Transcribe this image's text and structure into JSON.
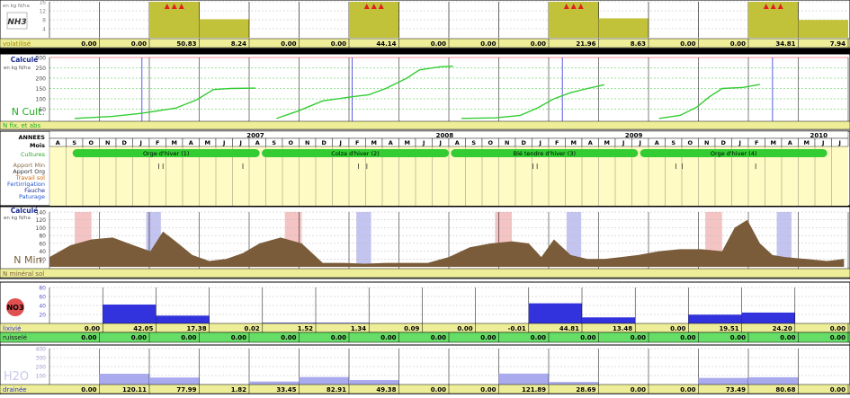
{
  "colors": {
    "olive": "#c2c23a",
    "yellow_bg": "#fffbc4",
    "green_bar": "#33cc33",
    "green_row": "#66dd66",
    "grid_green": "#33cc33",
    "grid_red": "#ee3333",
    "grid_gray": "#bbbbbb",
    "blue_line": "#3333dd",
    "nmin_fill": "#7a5c3a",
    "nitrate_fill": "#3333dd",
    "water_fill": "#aaaaee",
    "value_row": "#eeee99",
    "frame": "#000000"
  },
  "panels": {
    "nh3": {
      "unit": "en kg N/ha",
      "badge": "NH3",
      "row_label": "volatilisé",
      "warning_icon": "triangle-warning-icon",
      "chart_data": {
        "type": "bar",
        "ylim": [
          0,
          16
        ],
        "yticks": [
          4,
          8,
          12,
          16
        ],
        "categories": [
          "1",
          "2",
          "3",
          "4",
          "5",
          "6",
          "7",
          "8",
          "9",
          "10",
          "11",
          "12",
          "13",
          "14",
          "15",
          "16"
        ],
        "values": [
          0.0,
          0.0,
          50.83,
          8.24,
          0.0,
          0.0,
          44.14,
          0.0,
          0.0,
          0.0,
          21.96,
          8.63,
          0.0,
          0.0,
          34.81,
          7.94
        ],
        "labels": [
          "0.00",
          "0.00",
          "50.83",
          "8.24",
          "0.00",
          "0.00",
          "44.14",
          "0.00",
          "0.00",
          "0.00",
          "21.96",
          "8.63",
          "0.00",
          "0.00",
          "34.81",
          "7.94"
        ],
        "warnings": [
          2,
          6,
          10,
          14
        ]
      }
    },
    "ncult": {
      "header": "Calculé",
      "unit": "en kg N/ha",
      "title": "N Cult.",
      "footer": "N fix. et abs",
      "chart_data": {
        "type": "line",
        "ylim": [
          0,
          300
        ],
        "yticks": [
          50,
          100,
          150,
          200,
          250,
          300
        ],
        "series": [
          {
            "segment": 1,
            "points": [
              [
                0.6,
                5
              ],
              [
                1.5,
                15
              ],
              [
                2.2,
                30
              ],
              [
                3.0,
                55
              ],
              [
                3.5,
                95
              ],
              [
                3.9,
                145
              ],
              [
                4.3,
                150
              ],
              [
                4.9,
                152
              ]
            ]
          },
          {
            "segment": 2,
            "points": [
              [
                5.4,
                5
              ],
              [
                5.9,
                40
              ],
              [
                6.5,
                90
              ],
              [
                7.2,
                110
              ],
              [
                7.6,
                120
              ],
              [
                8.0,
                150
              ],
              [
                8.5,
                200
              ],
              [
                8.8,
                240
              ],
              [
                9.3,
                255
              ],
              [
                9.6,
                258
              ]
            ]
          },
          {
            "segment": 3,
            "points": [
              [
                9.8,
                5
              ],
              [
                10.6,
                8
              ],
              [
                11.2,
                20
              ],
              [
                11.6,
                55
              ],
              [
                12.0,
                100
              ],
              [
                12.4,
                130
              ],
              [
                12.8,
                150
              ],
              [
                13.2,
                168
              ]
            ]
          },
          {
            "segment": 4,
            "points": [
              [
                14.5,
                5
              ],
              [
                15.0,
                20
              ],
              [
                15.4,
                60
              ],
              [
                15.7,
                110
              ],
              [
                16.0,
                150
              ],
              [
                16.5,
                155
              ],
              [
                16.9,
                170
              ]
            ]
          }
        ]
      }
    },
    "calendar": {
      "row_labels": [
        "ANNEES",
        "Mois",
        "Cultures",
        "Apport Min",
        "Apport Org",
        "Travail sol",
        "Fertirrigation",
        "Fauche",
        "Paturage"
      ],
      "years": [
        {
          "label": "2007",
          "pos": 4.9
        },
        {
          "label": "2008",
          "pos": 9.4
        },
        {
          "label": "2009",
          "pos": 13.9
        },
        {
          "label": "2010",
          "pos": 18.3
        }
      ],
      "months": [
        "A",
        "S",
        "O",
        "N",
        "D",
        "J",
        "F",
        "M",
        "A",
        "M",
        "J",
        "J",
        "A",
        "S",
        "O",
        "N",
        "D",
        "J",
        "F",
        "M",
        "A",
        "M",
        "J",
        "J",
        "A",
        "S",
        "O",
        "N",
        "D",
        "J",
        "F",
        "M",
        "A",
        "M",
        "J",
        "J",
        "A",
        "S",
        "O",
        "N",
        "D",
        "J",
        "F",
        "M",
        "A",
        "M",
        "J",
        "J"
      ],
      "crops": [
        {
          "label": "Orge d'hiver (1)",
          "start": 0.55,
          "end": 5.0
        },
        {
          "label": "Colza d'hiver (2)",
          "start": 5.05,
          "end": 9.5
        },
        {
          "label": "Blé tendre d'hiver (3)",
          "start": 9.55,
          "end": 14.0
        },
        {
          "label": "Orge d'hiver (4)",
          "start": 14.05,
          "end": 18.5
        }
      ],
      "events": [
        2.6,
        2.7,
        4.6,
        7.35,
        7.55,
        11.5,
        11.6,
        14.9,
        15.05,
        16.8
      ]
    },
    "nmin": {
      "header": "Calculé",
      "unit": "en kg N/ha",
      "title": "N Min.",
      "footer": "N minéral sol",
      "chart_data": {
        "type": "area",
        "ylim": [
          0,
          140
        ],
        "yticks": [
          20,
          40,
          60,
          80,
          100,
          120,
          140
        ],
        "x": [
          0,
          0.5,
          1.0,
          1.5,
          2.0,
          2.4,
          2.7,
          3.0,
          3.4,
          3.8,
          4.2,
          4.6,
          5.0,
          5.5,
          6.0,
          6.5,
          7.0,
          7.5,
          8.0,
          8.5,
          9.0,
          9.5,
          10.0,
          10.5,
          11.0,
          11.4,
          11.7,
          12.0,
          12.4,
          12.8,
          13.2,
          13.6,
          14.0,
          14.5,
          15.0,
          15.5,
          16.0,
          16.3,
          16.6,
          16.9,
          17.2,
          17.5,
          18.0,
          18.5,
          18.9
        ],
        "values": [
          25,
          55,
          70,
          75,
          55,
          40,
          90,
          65,
          30,
          15,
          20,
          35,
          60,
          75,
          60,
          10,
          10,
          8,
          10,
          10,
          10,
          25,
          50,
          60,
          65,
          60,
          25,
          70,
          30,
          20,
          20,
          25,
          30,
          40,
          45,
          45,
          40,
          100,
          120,
          60,
          30,
          25,
          20,
          15,
          20
        ],
        "shading": [
          {
            "kind": "red",
            "start": 0.6,
            "end": 1.0
          },
          {
            "kind": "blue",
            "start": 2.3,
            "end": 2.65
          },
          {
            "kind": "red",
            "start": 5.6,
            "end": 6.0
          },
          {
            "kind": "blue",
            "start": 7.3,
            "end": 7.65
          },
          {
            "kind": "red",
            "start": 10.6,
            "end": 11.0
          },
          {
            "kind": "blue",
            "start": 12.3,
            "end": 12.65
          },
          {
            "kind": "red",
            "start": 15.6,
            "end": 16.0
          },
          {
            "kind": "blue",
            "start": 17.3,
            "end": 17.65
          }
        ]
      }
    },
    "no3": {
      "badge": "NO3",
      "row_labels": [
        "lixivié",
        "ruisselé"
      ],
      "chart_data": {
        "type": "bar",
        "ylim": [
          0,
          80
        ],
        "yticks": [
          20,
          40,
          60,
          80
        ],
        "values": [
          0.0,
          42.05,
          17.38,
          0.02,
          1.52,
          1.34,
          0.09,
          0.0,
          -0.01,
          44.81,
          13.48,
          0.0,
          19.51,
          24.2,
          0.0
        ],
        "labels_lixivie": [
          "0.00",
          "42.05",
          "17.38",
          "0.02",
          "1.52",
          "1.34",
          "0.09",
          "0.00",
          "-0.01",
          "44.81",
          "13.48",
          "0.00",
          "19.51",
          "24.20",
          "0.00"
        ],
        "labels_ruissele": [
          "0.00",
          "0.00",
          "0.00",
          "0.00",
          "0.00",
          "0.00",
          "0.00",
          "0.00",
          "0.00",
          "0.00",
          "0.00",
          "0.00",
          "0.00",
          "0.00",
          "0.00",
          "0.00"
        ]
      }
    },
    "h2o": {
      "badge": "H2O",
      "row_label": "drainée",
      "chart_data": {
        "type": "bar",
        "ylim": [
          0,
          400
        ],
        "yticks": [
          100,
          200,
          300,
          400
        ],
        "values": [
          0.0,
          120.11,
          77.99,
          1.82,
          33.45,
          82.91,
          49.38,
          0.0,
          0.0,
          121.89,
          28.69,
          0.0,
          0.0,
          73.49,
          80.68,
          0.0
        ],
        "labels": [
          "0.00",
          "120.11",
          "77.99",
          "1.82",
          "33.45",
          "82.91",
          "49.38",
          "0.00",
          "0.00",
          "121.89",
          "28.69",
          "0.00",
          "0.00",
          "73.49",
          "80.68",
          "0.00"
        ]
      }
    }
  }
}
